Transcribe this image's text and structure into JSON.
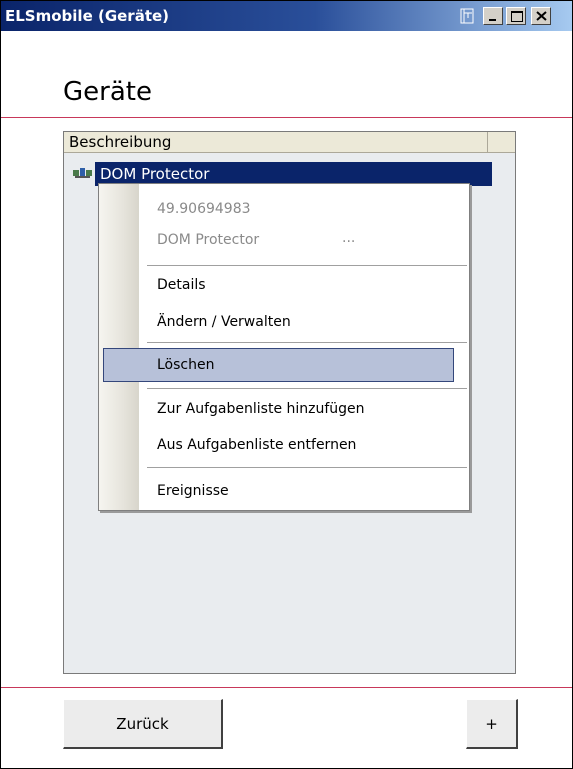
{
  "window": {
    "title": "ELSmobile (Geräte)",
    "controls": [
      "minimize-icon",
      "maximize-icon",
      "close-icon"
    ]
  },
  "page": {
    "title": "Geräte"
  },
  "list": {
    "column_header": "Beschreibung",
    "rows": [
      {
        "label": "DOM Protector",
        "selected": true,
        "icon": "device-icon"
      }
    ]
  },
  "context_menu": {
    "info_id": "49.90694983",
    "info_name": "DOM Protector",
    "info_more": "...",
    "items": [
      {
        "label": "Details"
      },
      {
        "label": "Ändern / Verwalten"
      },
      {
        "label": "Löschen",
        "highlighted": true
      },
      {
        "label": "Zur Aufgabenliste hinzufügen"
      },
      {
        "label": "Aus Aufgabenliste entfernen"
      },
      {
        "label": "Ereignisse"
      }
    ]
  },
  "footer": {
    "back_label": "Zurück",
    "add_label": "+"
  },
  "colors": {
    "accent_line": "#c8385a",
    "selection": "#0a246a",
    "menu_highlight": "#b7c1d9"
  }
}
